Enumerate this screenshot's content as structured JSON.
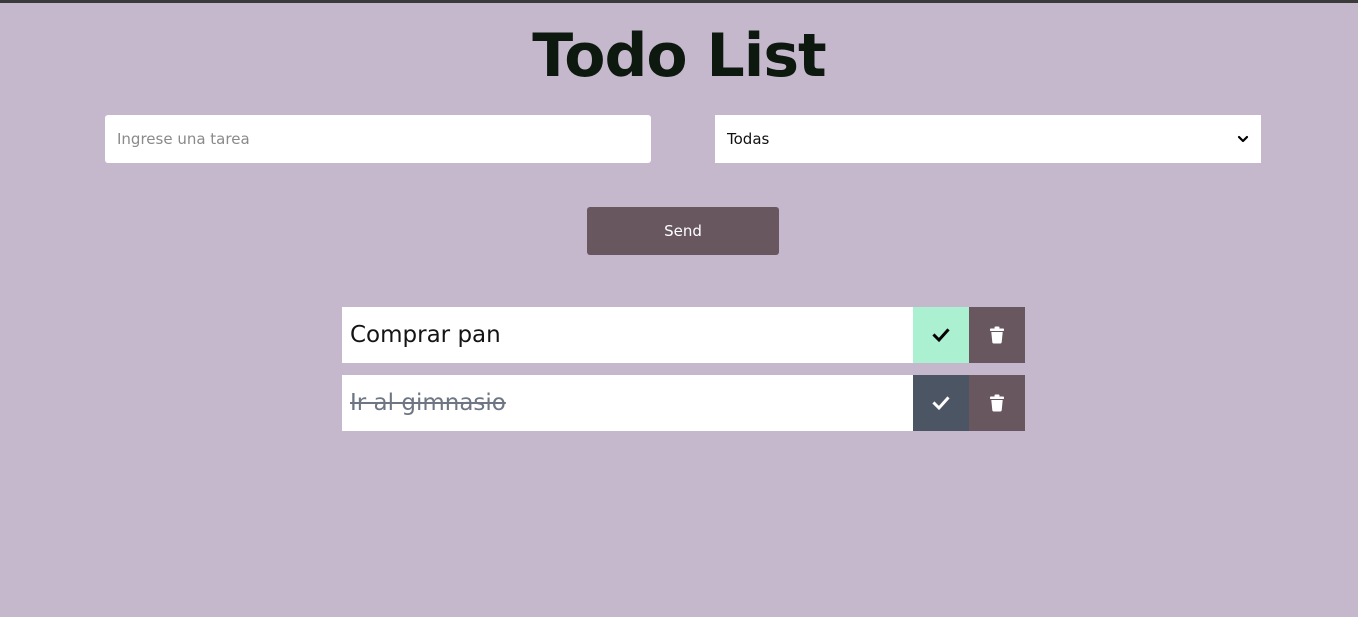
{
  "header": {
    "title": "Todo List"
  },
  "form": {
    "input_placeholder": "Ingrese una tarea",
    "input_value": "",
    "filter_selected": "Todas",
    "send_label": "Send"
  },
  "todos": [
    {
      "text": "Comprar pan",
      "completed": false,
      "check_icon": "check-icon",
      "delete_icon": "trash-icon"
    },
    {
      "text": "Ir al gimnasio",
      "completed": true,
      "check_icon": "check-icon",
      "delete_icon": "trash-icon"
    }
  ],
  "colors": {
    "background": "#c5b8cd",
    "button": "#695760",
    "check_active": "#aaf0d1",
    "check_completed": "#4b5563"
  }
}
